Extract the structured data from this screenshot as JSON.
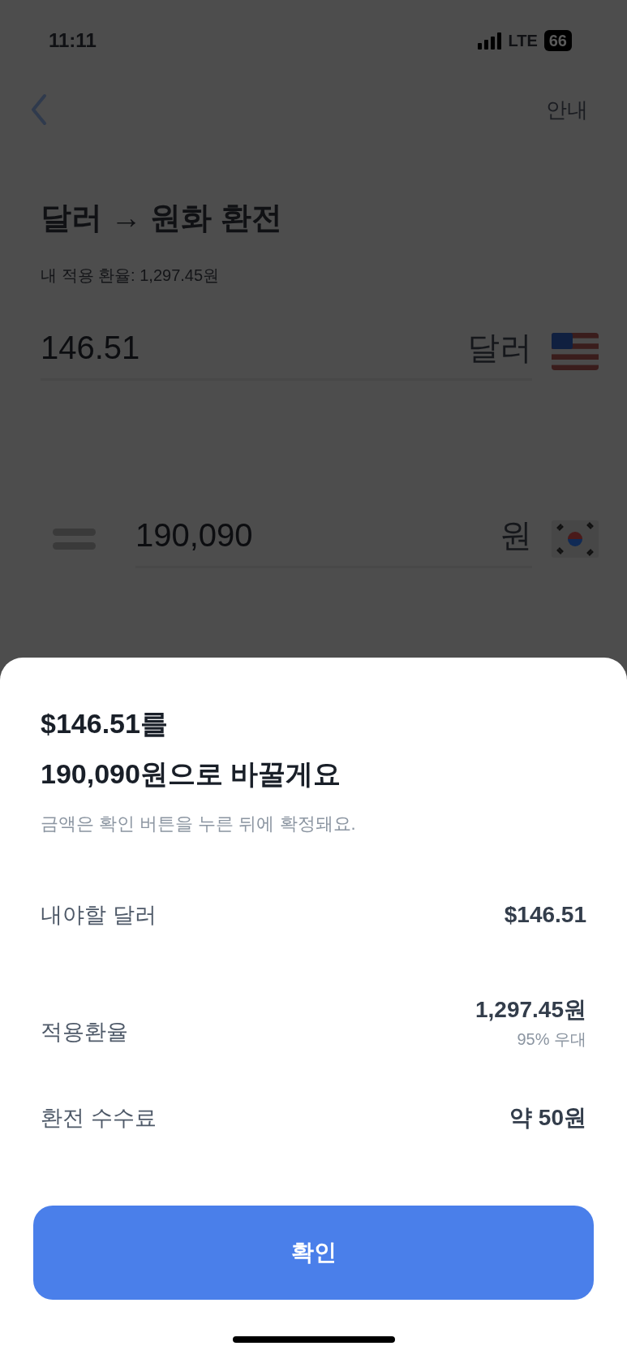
{
  "status_bar": {
    "time": "11:11",
    "network": "LTE",
    "battery": "66"
  },
  "nav": {
    "action": "안내"
  },
  "title": "달러 → 원화 환전",
  "rate_note": "내 적용 환율: 1,297.45원",
  "from": {
    "value": "146.51",
    "unit": "달러"
  },
  "to": {
    "value": "190,090",
    "unit": "원"
  },
  "sheet": {
    "heading_lines": [
      "$146.51를",
      "190,090원으로 바꿀게요"
    ],
    "note": "금액은 확인 버튼을 누른 뒤에 확정돼요.",
    "rows": [
      {
        "label": "내야할 달러",
        "value": "$146.51"
      },
      {
        "label": "적용환율",
        "value": "1,297.45원",
        "sub": "95% 우대"
      },
      {
        "label": "환전 수수료",
        "value": "약 50원"
      }
    ],
    "button": "확인"
  }
}
